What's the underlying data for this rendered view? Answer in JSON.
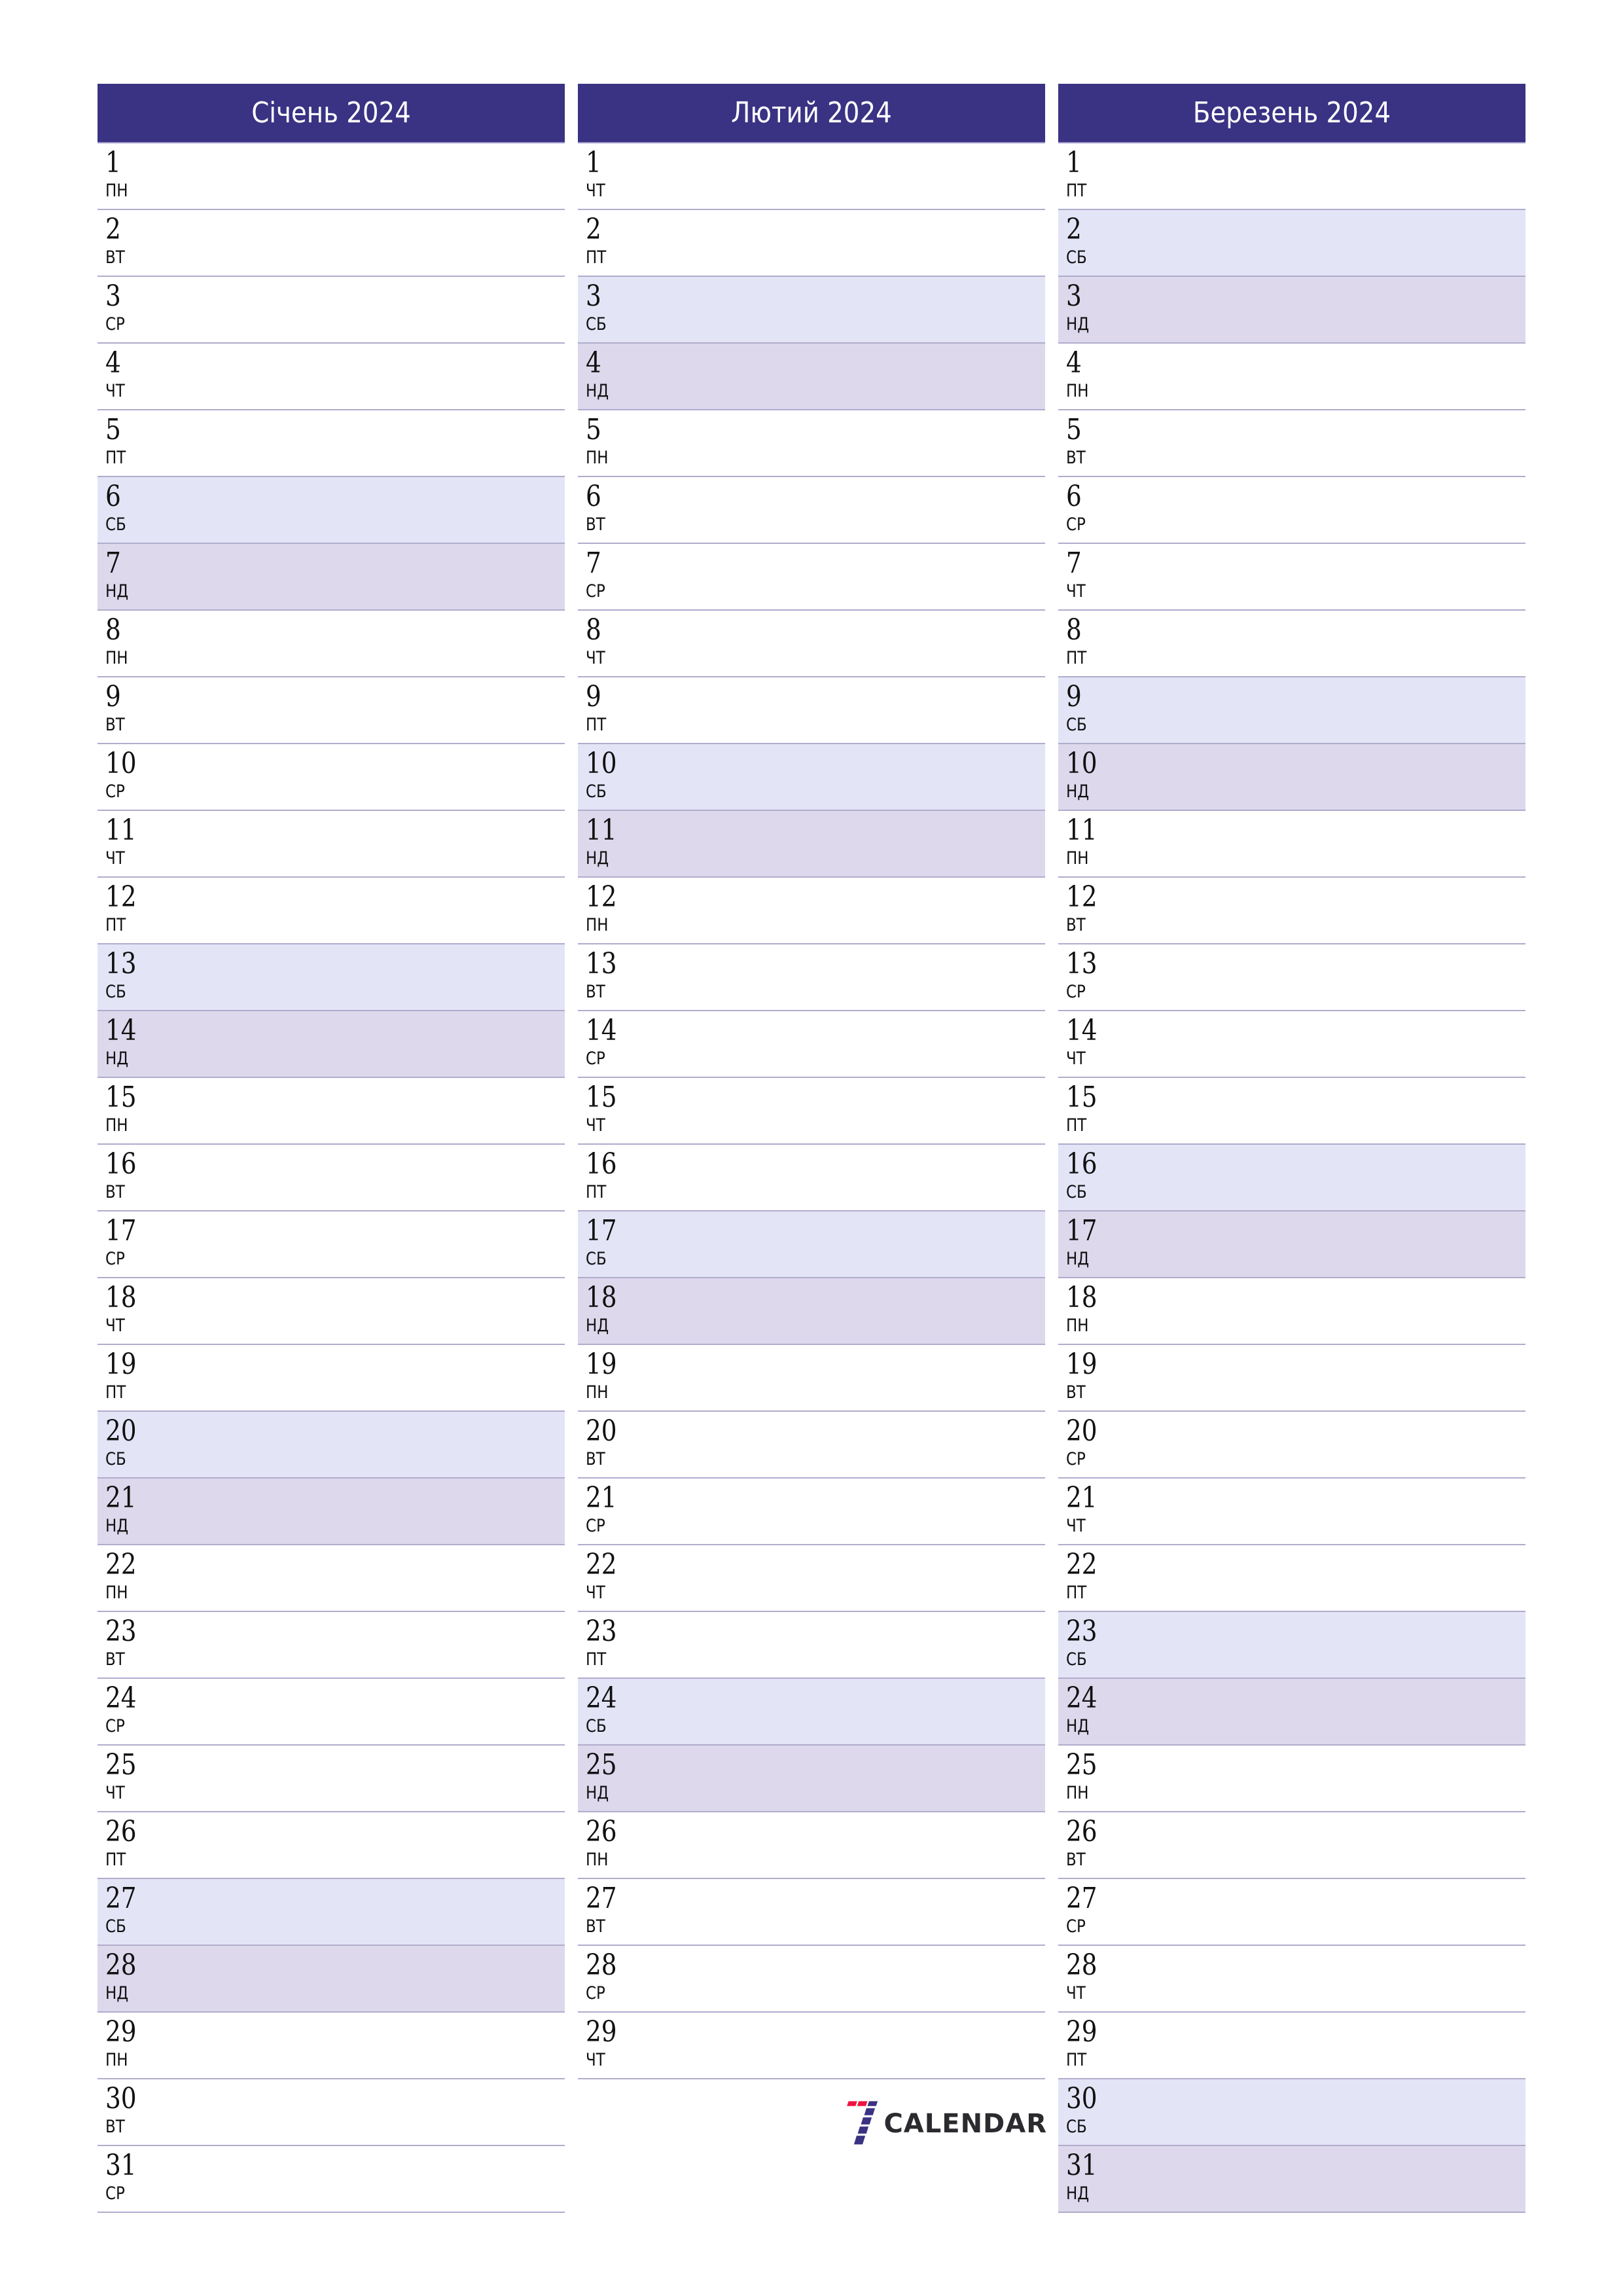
{
  "colors": {
    "header_bg": "#3a3283",
    "saturday_bg": "#e4e4f7",
    "sunday_bg": "#ddd8ec",
    "divider": "#b0accc",
    "logo_red": "#ee1442",
    "logo_blue": "#3a3283"
  },
  "months": [
    {
      "title": "Січень 2024",
      "days": [
        {
          "n": "1",
          "d": "ПН"
        },
        {
          "n": "2",
          "d": "ВТ"
        },
        {
          "n": "3",
          "d": "СР"
        },
        {
          "n": "4",
          "d": "ЧТ"
        },
        {
          "n": "5",
          "d": "ПТ"
        },
        {
          "n": "6",
          "d": "СБ",
          "w": "sat"
        },
        {
          "n": "7",
          "d": "НД",
          "w": "sun"
        },
        {
          "n": "8",
          "d": "ПН"
        },
        {
          "n": "9",
          "d": "ВТ"
        },
        {
          "n": "10",
          "d": "СР"
        },
        {
          "n": "11",
          "d": "ЧТ"
        },
        {
          "n": "12",
          "d": "ПТ"
        },
        {
          "n": "13",
          "d": "СБ",
          "w": "sat"
        },
        {
          "n": "14",
          "d": "НД",
          "w": "sun"
        },
        {
          "n": "15",
          "d": "ПН"
        },
        {
          "n": "16",
          "d": "ВТ"
        },
        {
          "n": "17",
          "d": "СР"
        },
        {
          "n": "18",
          "d": "ЧТ"
        },
        {
          "n": "19",
          "d": "ПТ"
        },
        {
          "n": "20",
          "d": "СБ",
          "w": "sat"
        },
        {
          "n": "21",
          "d": "НД",
          "w": "sun"
        },
        {
          "n": "22",
          "d": "ПН"
        },
        {
          "n": "23",
          "d": "ВТ"
        },
        {
          "n": "24",
          "d": "СР"
        },
        {
          "n": "25",
          "d": "ЧТ"
        },
        {
          "n": "26",
          "d": "ПТ"
        },
        {
          "n": "27",
          "d": "СБ",
          "w": "sat"
        },
        {
          "n": "28",
          "d": "НД",
          "w": "sun"
        },
        {
          "n": "29",
          "d": "ПН"
        },
        {
          "n": "30",
          "d": "ВТ"
        },
        {
          "n": "31",
          "d": "СР"
        }
      ]
    },
    {
      "title": "Лютий 2024",
      "days": [
        {
          "n": "1",
          "d": "ЧТ"
        },
        {
          "n": "2",
          "d": "ПТ"
        },
        {
          "n": "3",
          "d": "СБ",
          "w": "sat"
        },
        {
          "n": "4",
          "d": "НД",
          "w": "sun"
        },
        {
          "n": "5",
          "d": "ПН"
        },
        {
          "n": "6",
          "d": "ВТ"
        },
        {
          "n": "7",
          "d": "СР"
        },
        {
          "n": "8",
          "d": "ЧТ"
        },
        {
          "n": "9",
          "d": "ПТ"
        },
        {
          "n": "10",
          "d": "СБ",
          "w": "sat"
        },
        {
          "n": "11",
          "d": "НД",
          "w": "sun"
        },
        {
          "n": "12",
          "d": "ПН"
        },
        {
          "n": "13",
          "d": "ВТ"
        },
        {
          "n": "14",
          "d": "СР"
        },
        {
          "n": "15",
          "d": "ЧТ"
        },
        {
          "n": "16",
          "d": "ПТ"
        },
        {
          "n": "17",
          "d": "СБ",
          "w": "sat"
        },
        {
          "n": "18",
          "d": "НД",
          "w": "sun"
        },
        {
          "n": "19",
          "d": "ПН"
        },
        {
          "n": "20",
          "d": "ВТ"
        },
        {
          "n": "21",
          "d": "СР"
        },
        {
          "n": "22",
          "d": "ЧТ"
        },
        {
          "n": "23",
          "d": "ПТ"
        },
        {
          "n": "24",
          "d": "СБ",
          "w": "sat"
        },
        {
          "n": "25",
          "d": "НД",
          "w": "sun"
        },
        {
          "n": "26",
          "d": "ПН"
        },
        {
          "n": "27",
          "d": "ВТ"
        },
        {
          "n": "28",
          "d": "СР"
        },
        {
          "n": "29",
          "d": "ЧТ"
        }
      ]
    },
    {
      "title": "Березень 2024",
      "days": [
        {
          "n": "1",
          "d": "ПТ"
        },
        {
          "n": "2",
          "d": "СБ",
          "w": "sat"
        },
        {
          "n": "3",
          "d": "НД",
          "w": "sun"
        },
        {
          "n": "4",
          "d": "ПН"
        },
        {
          "n": "5",
          "d": "ВТ"
        },
        {
          "n": "6",
          "d": "СР"
        },
        {
          "n": "7",
          "d": "ЧТ"
        },
        {
          "n": "8",
          "d": "ПТ"
        },
        {
          "n": "9",
          "d": "СБ",
          "w": "sat"
        },
        {
          "n": "10",
          "d": "НД",
          "w": "sun"
        },
        {
          "n": "11",
          "d": "ПН"
        },
        {
          "n": "12",
          "d": "ВТ"
        },
        {
          "n": "13",
          "d": "СР"
        },
        {
          "n": "14",
          "d": "ЧТ"
        },
        {
          "n": "15",
          "d": "ПТ"
        },
        {
          "n": "16",
          "d": "СБ",
          "w": "sat"
        },
        {
          "n": "17",
          "d": "НД",
          "w": "sun"
        },
        {
          "n": "18",
          "d": "ПН"
        },
        {
          "n": "19",
          "d": "ВТ"
        },
        {
          "n": "20",
          "d": "СР"
        },
        {
          "n": "21",
          "d": "ЧТ"
        },
        {
          "n": "22",
          "d": "ПТ"
        },
        {
          "n": "23",
          "d": "СБ",
          "w": "sat"
        },
        {
          "n": "24",
          "d": "НД",
          "w": "sun"
        },
        {
          "n": "25",
          "d": "ПН"
        },
        {
          "n": "26",
          "d": "ВТ"
        },
        {
          "n": "27",
          "d": "СР"
        },
        {
          "n": "28",
          "d": "ЧТ"
        },
        {
          "n": "29",
          "d": "ПТ"
        },
        {
          "n": "30",
          "d": "СБ",
          "w": "sat"
        },
        {
          "n": "31",
          "d": "НД",
          "w": "sun"
        }
      ]
    }
  ],
  "logo": {
    "icon": "seven-calendar-logo-icon",
    "text": "CALENDAR"
  }
}
